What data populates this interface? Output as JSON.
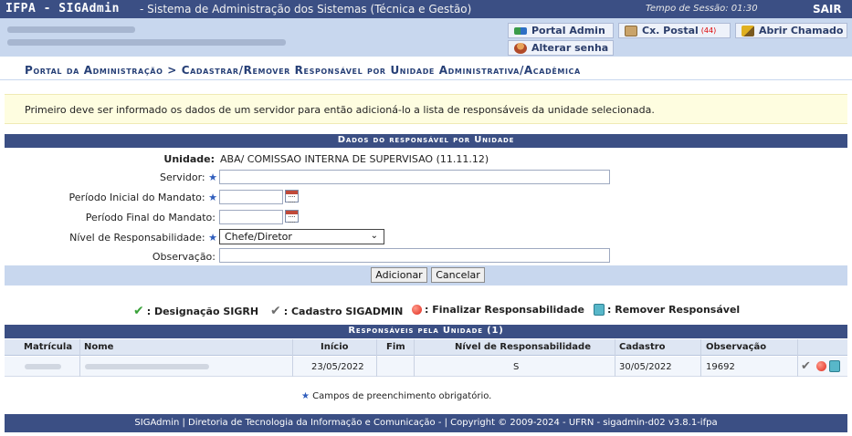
{
  "topbar": {
    "brand": "IFPA - SIGAdmin",
    "subtitle": "- Sistema de Administração dos Sistemas (Técnica e Gestão)",
    "session": "Tempo de Sessão: 01:30",
    "logout": "SAIR"
  },
  "menu": {
    "portal_admin": "Portal Admin",
    "cx_postal": "Cx. Postal",
    "cx_postal_count": "(44)",
    "abrir_chamado": "Abrir Chamado",
    "alterar_senha": "Alterar senha"
  },
  "breadcrumb": "Portal da Administração > Cadastrar/Remover Responsável por Unidade Administrativa/Acadêmica",
  "notice": "Primeiro deve ser informado os dados de um servidor para então adicioná-lo a lista de responsáveis da unidade selecionada.",
  "form": {
    "title": "Dados do responsável por Unidade",
    "unidade_label": "Unidade:",
    "unidade_value": "ABA/ COMISSAO INTERNA DE SUPERVISAO (11.11.12)",
    "servidor_label": "Servidor:",
    "periodo_inicial_label": "Período Inicial do Mandato:",
    "periodo_final_label": "Período Final do Mandato:",
    "nivel_label": "Nível de Responsabilidade:",
    "nivel_value": "Chefe/Diretor",
    "observacao_label": "Observação:",
    "required_mark": "★",
    "add_button": "Adicionar",
    "cancel_button": "Cancelar"
  },
  "legend": {
    "designacao": ": Designação SIGRH",
    "cadastro": ": Cadastro SIGADMIN",
    "finalizar": ": Finalizar Responsabilidade",
    "remover": ": Remover Responsável"
  },
  "table": {
    "title": "Responsáveis pela Unidade (1)",
    "headers": [
      "Matrícula",
      "Nome",
      "Início",
      "Fim",
      "Nível de Responsabilidade",
      "Cadastro",
      "Observação"
    ],
    "rows": [
      {
        "inicio": "23/05/2022",
        "fim": "",
        "nivel": "S",
        "cadastro": "30/05/2022",
        "observacao": "19692"
      }
    ]
  },
  "required_note": "★ Campos de preenchimento obrigatório.",
  "footer": "SIGAdmin | Diretoria de Tecnologia da Informação e Comunicação - | Copyright © 2009-2024 - UFRN - sigadmin-d02 v3.8.1-ifpa",
  "colors": {
    "header_blue": "#3b4f84",
    "light_blue": "#c8d7ee",
    "notice_yellow": "#fefde0",
    "required_star": "#2f5dbc"
  }
}
